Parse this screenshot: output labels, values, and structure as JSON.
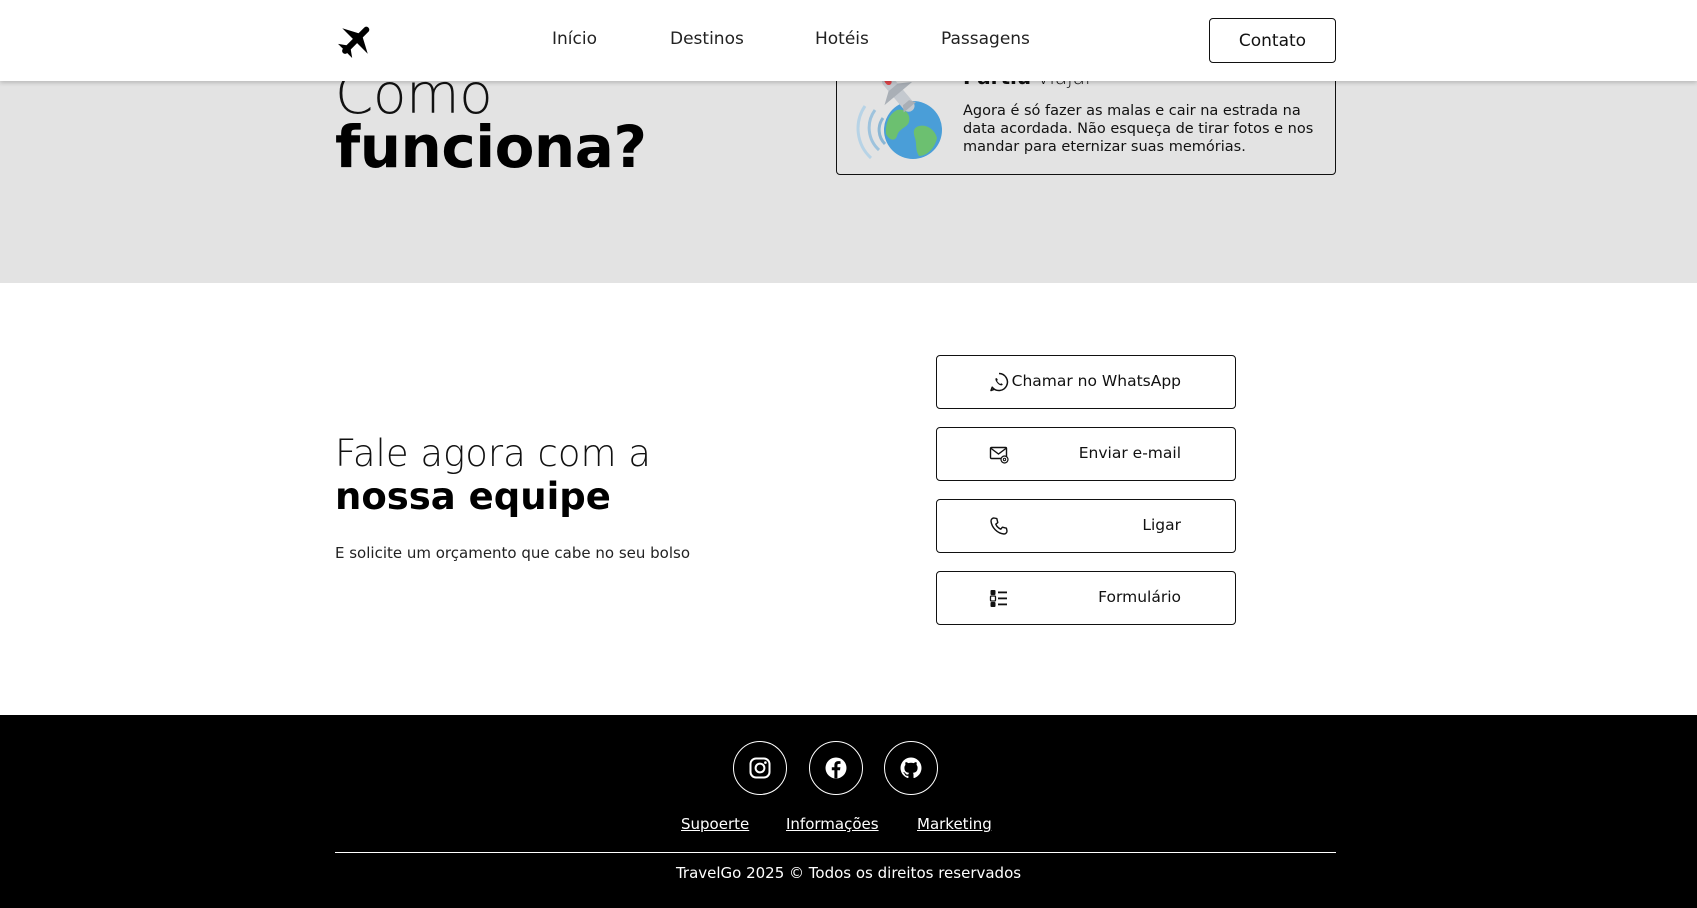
{
  "nav": {
    "logo_icon": "airplane-icon",
    "links": [
      "Início",
      "Destinos",
      "Hotéis",
      "Passagens"
    ],
    "contact_label": "Contato"
  },
  "how": {
    "title_light": "Como",
    "title_bold": "funciona?",
    "step": {
      "heading_bold": "Partiu",
      "heading_light": "viajar",
      "text": "Agora é só fazer as malas e cair na estrada na data acordada. Não esqueça de tirar fotos e nos mandar para eternizar suas memórias.",
      "illustration": "airplane-globe-illustration"
    }
  },
  "contact": {
    "title_light": "Fale agora com a",
    "title_bold": "nossa equipe",
    "subtitle": "E solicite um orçamento que cabe no seu bolso",
    "buttons": [
      {
        "label": "Chamar no WhatsApp",
        "icon": "whatsapp-icon"
      },
      {
        "label": "Enviar e-mail",
        "icon": "email-icon"
      },
      {
        "label": "Ligar",
        "icon": "phone-icon"
      },
      {
        "label": "Formulário",
        "icon": "checklist-icon"
      }
    ]
  },
  "footer": {
    "social": [
      "instagram-icon",
      "facebook-icon",
      "github-icon"
    ],
    "links": [
      "Supoerte",
      "Informações",
      "Marketing"
    ],
    "copyright": "TravelGo 2025 © Todos os direitos reservados"
  },
  "colors": {
    "band_bg": "#e3e3e3",
    "footer_bg": "#000000",
    "text": "#111111"
  }
}
